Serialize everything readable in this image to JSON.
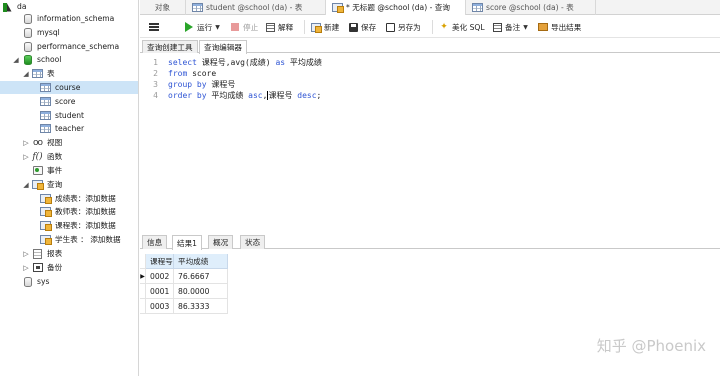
{
  "sidebar": {
    "root": "da",
    "databases": [
      "information_schema",
      "mysql",
      "performance_schema"
    ],
    "school": "school",
    "tables_label": "表",
    "tables": [
      "course",
      "score",
      "student",
      "teacher"
    ],
    "views_label": "视图",
    "functions_label": "函数",
    "events_label": "事件",
    "queries_label": "查询",
    "queries": [
      "成绩表：添加数据",
      "教师表：添加数据",
      "课程表：添加数据",
      "学生表 ： 添加数据"
    ],
    "reports_label": "报表",
    "backup_label": "备份",
    "sys": "sys"
  },
  "tabs": [
    {
      "label": "对象"
    },
    {
      "label": "student @school (da) - 表"
    },
    {
      "label": "* 无标题 @school (da) - 查询"
    },
    {
      "label": "score @school (da) - 表"
    }
  ],
  "toolbar": {
    "run": "运行",
    "stop": "停止",
    "explain": "解释",
    "new": "新建",
    "save": "保存",
    "save_as": "另存为",
    "beautify": "美化 SQL",
    "notes": "备注",
    "export": "导出结果"
  },
  "subtabs": [
    "查询创建工具",
    "查询编辑器"
  ],
  "editor": {
    "lines": [
      {
        "n": "1",
        "parts": [
          {
            "k": "kw",
            "t": "select"
          },
          {
            "k": "tx",
            "t": " 课程号,avg(成绩) "
          },
          {
            "k": "kw",
            "t": "as"
          },
          {
            "k": "tx",
            "t": " 平均成绩"
          }
        ]
      },
      {
        "n": "2",
        "parts": [
          {
            "k": "kw",
            "t": "from"
          },
          {
            "k": "tx",
            "t": " score"
          }
        ]
      },
      {
        "n": "3",
        "parts": [
          {
            "k": "kw",
            "t": "group by"
          },
          {
            "k": "tx",
            "t": " 课程号"
          }
        ]
      },
      {
        "n": "4",
        "parts": [
          {
            "k": "kw",
            "t": "order by"
          },
          {
            "k": "tx",
            "t": " 平均成绩 "
          },
          {
            "k": "kw",
            "t": "asc"
          },
          {
            "k": "tx",
            "t": ","
          },
          {
            "k": "caret",
            "t": ""
          },
          {
            "k": "tx",
            "t": "课程号 "
          },
          {
            "k": "kw",
            "t": "desc"
          },
          {
            "k": "tx",
            "t": ";"
          }
        ]
      }
    ]
  },
  "result_tabs": [
    "信息",
    "结果1",
    "概况",
    "状态"
  ],
  "results": {
    "columns": [
      "课程号",
      "平均成绩"
    ],
    "rows": [
      [
        "0002",
        "76.6667"
      ],
      [
        "0001",
        "80.0000"
      ],
      [
        "0003",
        "86.3333"
      ]
    ]
  },
  "watermark": "知乎 @Phoenix"
}
